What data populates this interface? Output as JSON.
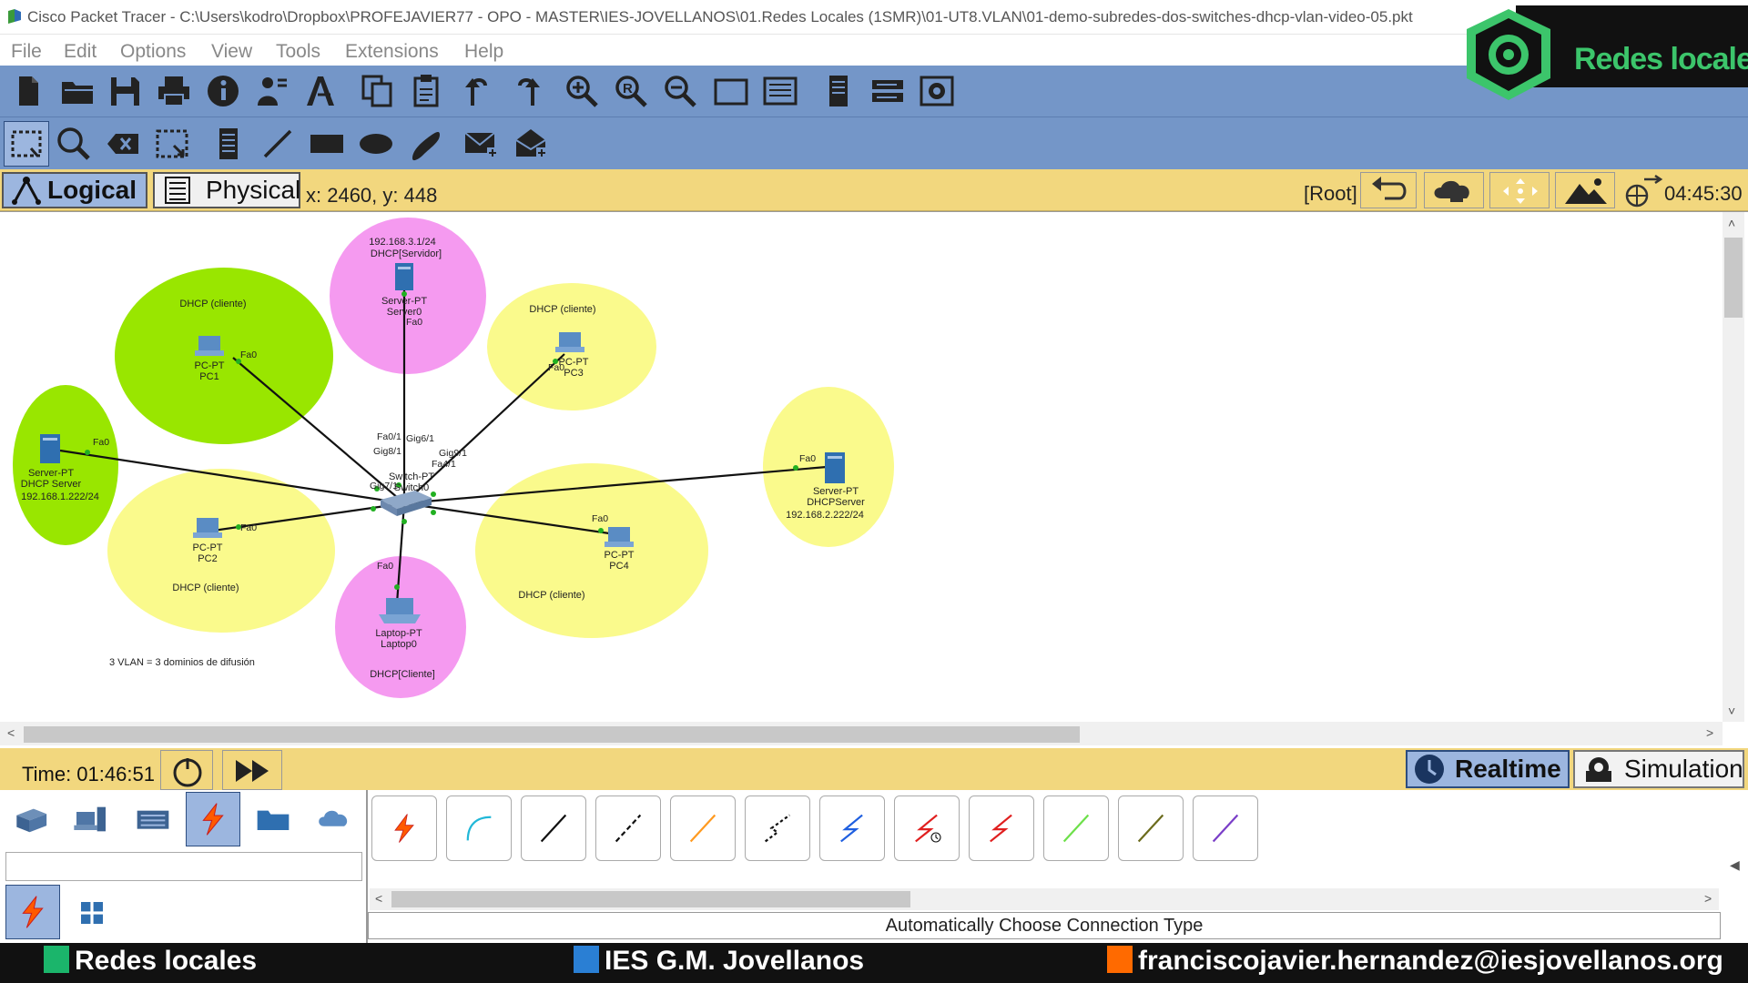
{
  "window": {
    "title": "Cisco Packet Tracer - C:\\Users\\kodro\\Dropbox\\PROFEJAVIER77 - OPO - MASTER\\IES-JOVELLANOS\\01.Redes Locales (1SMR)\\01-UT8.VLAN\\01-demo-subredes-dos-switches-dhcp-vlan-video-05.pkt"
  },
  "menu": [
    "File",
    "Edit",
    "Options",
    "View",
    "Tools",
    "Extensions",
    "Help"
  ],
  "logo": {
    "text": "Redes locales"
  },
  "tabs": {
    "logical": "Logical",
    "physical": "Physical"
  },
  "status": {
    "coords": "x: 2460, y: 448",
    "root": "[Root]",
    "clock": "04:45:30"
  },
  "diagram": {
    "zones": [
      {
        "label": "DHCP (cliente)",
        "color": "#99e600"
      },
      {
        "label": "192.168.3.1/24",
        "label2": "DHCP[Servidor]",
        "color": "#f59af0"
      },
      {
        "label": "DHCP (cliente)",
        "color": "#fafa8c"
      },
      {
        "label": "DHCP (cliente)",
        "color": "#fafa8c"
      },
      {
        "label": "DHCP (cliente)",
        "color": "#fafa8c"
      },
      {
        "label": "DHCP[Cliente]",
        "color": "#f59af0"
      }
    ],
    "devices": {
      "server0": [
        "Server-PT",
        "Server0"
      ],
      "pc1": [
        "PC-PT",
        "PC1"
      ],
      "pc3": [
        "PC-PT",
        "PC3"
      ],
      "dhcp1": [
        "Server-PT",
        "DHCP Server",
        "192.168.1.222/24"
      ],
      "pc2": [
        "PC-PT",
        "PC2"
      ],
      "pc4": [
        "PC-PT",
        "PC4"
      ],
      "dhcp2": [
        "Server-PT",
        "DHCPServer",
        "192.168.2.222/24"
      ],
      "laptop": [
        "Laptop-PT",
        "Laptop0"
      ],
      "switch": [
        "Switch-PT",
        "Switch0"
      ]
    },
    "ports": {
      "fa0": "Fa0",
      "fa01": "Fa0/1",
      "gig61": "Gig6/1",
      "gig81": "Gig8/1",
      "gig91": "Gig9/1",
      "gig71": "Gig7/1",
      "fa41": "Fa4/1"
    },
    "note": "3 VLAN = 3 dominios de difusión"
  },
  "time_bar": {
    "time": "Time: 01:46:51",
    "realtime": "Realtime",
    "simulation": "Simulation"
  },
  "palette": {
    "status": "Automatically Choose Connection Type"
  },
  "taskbar": {
    "items": [
      {
        "label": "Redes locales",
        "color": "#1bb56b"
      },
      {
        "label": "IES G.M. Jovellanos",
        "color": "#2a7fd4"
      },
      {
        "label": "franciscojavier.hernandez@iesjovellanos.org",
        "color": "#ff6a00"
      }
    ]
  }
}
